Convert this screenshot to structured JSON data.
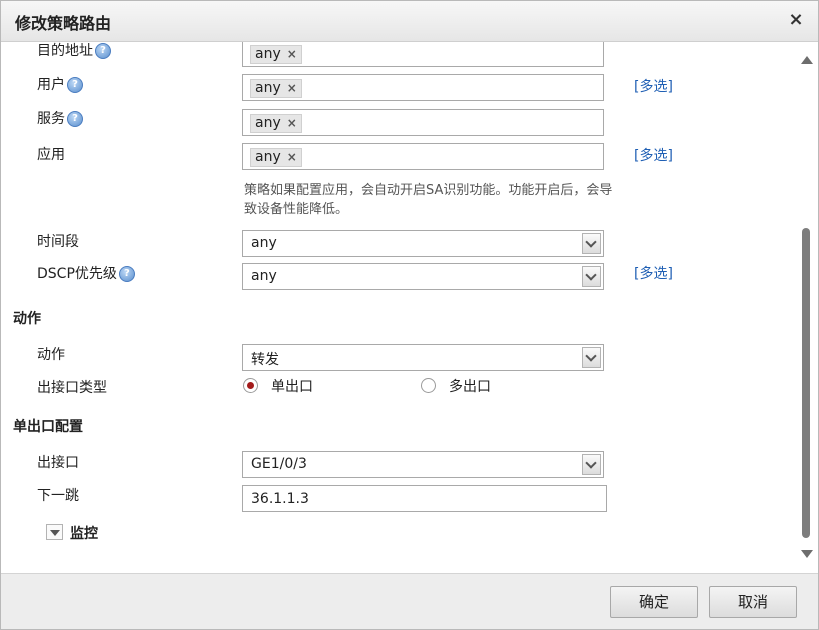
{
  "dialog": {
    "title": "修改策略路由",
    "close_label": "×"
  },
  "fields": {
    "destination": {
      "label": "目的地址",
      "tag": "any",
      "remove": "×"
    },
    "user": {
      "label": "用户",
      "tag": "any",
      "remove": "×",
      "multi_link": "[多选]"
    },
    "service": {
      "label": "服务",
      "tag": "any",
      "remove": "×"
    },
    "application": {
      "label": "应用",
      "tag": "any",
      "remove": "×",
      "multi_link": "[多选]",
      "hint": "策略如果配置应用，会自动开启SA识别功能。功能开启后，会导致设备性能降低。"
    },
    "time_range": {
      "label": "时间段",
      "value": "any"
    },
    "dscp": {
      "label": "DSCP优先级",
      "value": "any",
      "multi_link": "[多选]"
    }
  },
  "action_section": {
    "title": "动作",
    "action_label": "动作",
    "action_value": "转发",
    "egress_type_label": "出接口类型",
    "options": [
      {
        "label": "单出口",
        "selected": true
      },
      {
        "label": "多出口",
        "selected": false
      }
    ]
  },
  "single_egress_section": {
    "title": "单出口配置",
    "interface_label": "出接口",
    "interface_value": "GE1/0/3",
    "next_hop_label": "下一跳",
    "next_hop_value": "36.1.1.3"
  },
  "monitor": {
    "label": "监控"
  },
  "help_icon_glyph": "?",
  "footer": {
    "ok_label": "确定",
    "cancel_label": "取消"
  },
  "colors": {
    "link": "#1f5fb4",
    "radio_selected": "#a31b1b"
  }
}
